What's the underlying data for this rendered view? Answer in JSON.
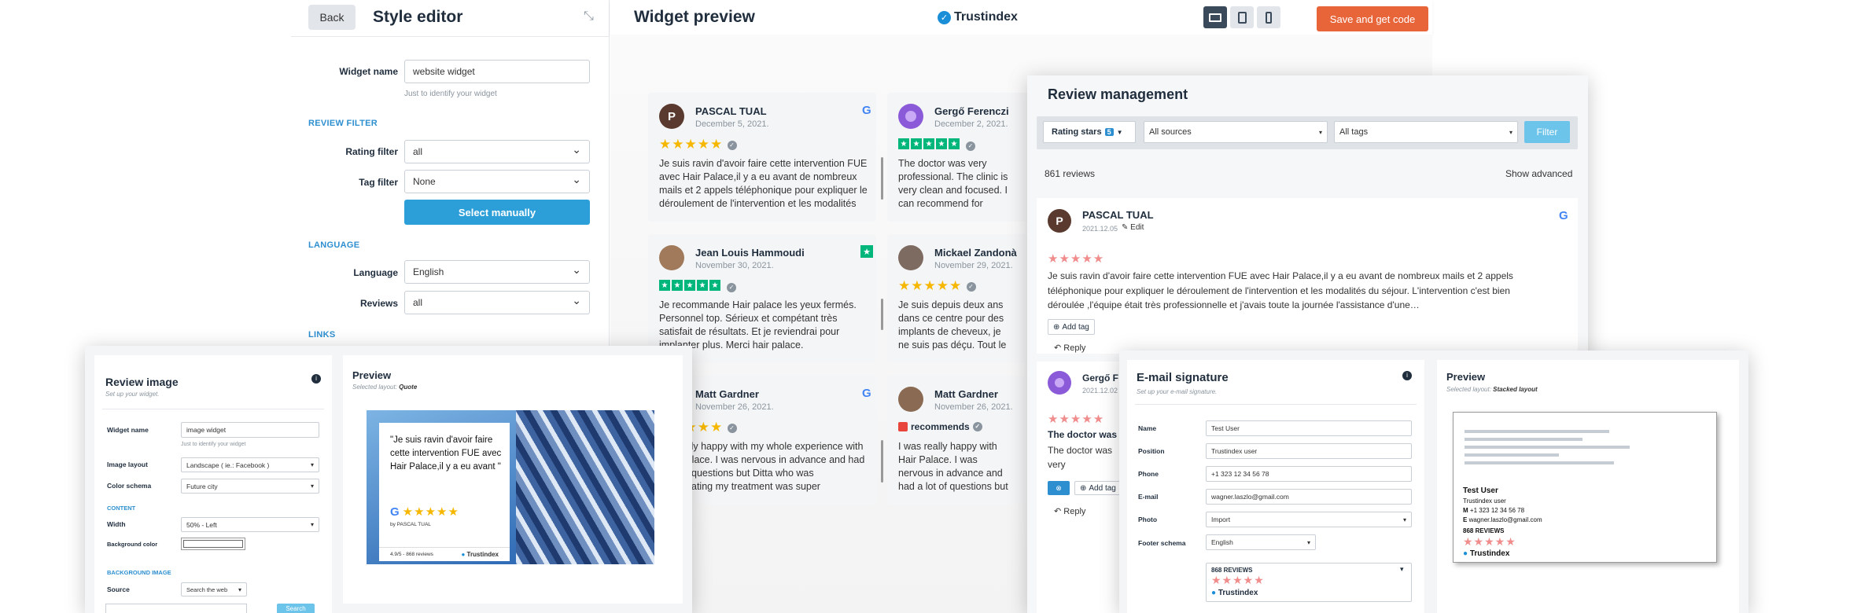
{
  "editor": {
    "back": "Back",
    "title": "Style editor",
    "widget_name_label": "Widget name",
    "widget_name_value": "website widget",
    "widget_name_hint": "Just to identify your widget",
    "review_filter_heading": "REVIEW FILTER",
    "rating_filter_label": "Rating filter",
    "rating_filter_value": "all",
    "tag_filter_label": "Tag filter",
    "tag_filter_value": "None",
    "select_manually": "Select manually",
    "language_heading": "LANGUAGE",
    "language_label": "Language",
    "language_value": "English",
    "reviews_label": "Reviews",
    "reviews_value": "all",
    "links_heading": "LINKS"
  },
  "preview_header": {
    "title": "Widget preview",
    "brand": "Trustindex",
    "save": "Save and get code"
  },
  "reviews": [
    {
      "initial": "P",
      "name": "PASCAL TUAL",
      "date": "December 5, 2021.",
      "text": "Je suis ravin d'avoir faire cette intervention FUE avec Hair Palace,il y a eu avant de nombreux mails et 2 appels téléphonique pour expliquer le déroulement de l'intervention et les modalités du"
    },
    {
      "initial": "",
      "name": "Gergő Ferenczi",
      "date": "December 2, 2021.",
      "text": "The doctor was very professional. The clinic is very clean and focused. I can recommend for everyone."
    },
    {
      "initial": "",
      "name": "Jean Louis Hammoudi",
      "date": "November 30, 2021.",
      "text": "Je recommande Hair palace les yeux fermés. Personnel top. Sérieux et compétant très satisfait de résultats. Et je reviendrai pour implanter plus. Merci hair palace."
    },
    {
      "initial": "",
      "name": "Mickael Zandonà",
      "date": "November 29, 2021.",
      "text": "Je suis depuis deux ans dans ce centre pour des implants de cheveux, je ne suis pas déçu. Tout le personnel est très bien dans l'organisation de"
    },
    {
      "initial": "",
      "name": "Matt Gardner",
      "date": "November 26, 2021.",
      "text": "I'm really happy with my whole experience with Hair Palace. I was nervous in advance and had a lot of questions but Ditta who was coordinating my treatment was super responsive and"
    },
    {
      "initial": "",
      "name": "Matt Gardner",
      "date": "November 26, 2021.",
      "recommends": "recommends",
      "text": "I was really happy with Hair Palace. I was nervous in advance and had a lot of questions but Ditta who was coordinating my treatment was super responsive and"
    }
  ],
  "management": {
    "title": "Review management",
    "rating_btn": "Rating stars",
    "rating_count": "5",
    "sources": "All sources",
    "tags": "All tags",
    "filter": "Filter",
    "count": "861 reviews",
    "show_advanced": "Show advanced",
    "r1": {
      "initial": "P",
      "name": "PASCAL TUAL",
      "date": "2021.12.05",
      "edit": "Edit",
      "text": "Je suis ravin d'avoir faire cette intervention FUE avec Hair Palace,il y a eu avant de nombreux mails et 2 appels téléphonique pour expliquer le déroulement de l'intervention et les modalités du séjour. L'intervention c'est bien déroulée ,l'équipe était très professionnelle et j'avais toute la journée l'assistance d'une…",
      "add_tag": "Add tag",
      "reply": "Reply"
    },
    "r2": {
      "name": "Gergő F",
      "date": "2021.12.02",
      "bold": "The doctor was",
      "text": "The doctor was very professional. The clinic is very clean and focused. I can recommend for everyone",
      "add_tag": "Add tag",
      "reply": "Reply"
    }
  },
  "review_image": {
    "title": "Review image",
    "subtitle": "Set up your widget.",
    "widget_name_label": "Widget name",
    "widget_name_value": "image widget",
    "widget_hint": "Just to identify your widget",
    "layout_label": "Image layout",
    "layout_value": "Landscape ( ie.: Facebook )",
    "color_label": "Color schema",
    "color_value": "Future city",
    "content_heading": "CONTENT",
    "width_label": "Width",
    "width_value": "50% - Left",
    "bg_label": "Background color",
    "bg_image_heading": "BACKGROUND IMAGE",
    "source_label": "Source",
    "source_value": "Search the web",
    "search": "Search",
    "preview_title": "Preview",
    "preview_layout_prefix": "Selected layout:",
    "preview_layout": "Quote",
    "quote": "\"Je suis ravin d'avoir faire cette intervention FUE avec Hair Palace,il y a eu avant \"",
    "by": "by PASCAL TUAL",
    "foot_rating": "4.9/5 - 868 reviews",
    "foot_brand": "Trustindex"
  },
  "email": {
    "title": "E-mail signature",
    "subtitle": "Set up your e-mail signature.",
    "name_label": "Name",
    "name_value": "Test User",
    "position_label": "Position",
    "position_value": "Trustindex user",
    "phone_label": "Phone",
    "phone_value": "+1 323 12 34 56 78",
    "email_label": "E-mail",
    "email_value": "wagner.laszlo@gmail.com",
    "photo_label": "Photo",
    "photo_value": "Import",
    "footer_label": "Footer schema",
    "footer_value": "English",
    "badge_count": "868 REVIEWS",
    "badge_brand": "Trustindex",
    "preview_title": "Preview",
    "preview_layout_prefix": "Selected layout:",
    "preview_layout": "Stacked layout",
    "sig_name": "Test User",
    "sig_pos": "Trustindex user",
    "sig_m": "M",
    "sig_phone": "+1 323 12 34 56 78",
    "sig_e": "E",
    "sig_email": "wagner.laszlo@gmail.com",
    "sig_reviews": "868 REVIEWS",
    "sig_brand": "Trustindex"
  },
  "colors": {
    "accent": "#2d8fd0",
    "save": "#e8653a",
    "google_blue": "#4285f4",
    "tp_green": "#00b67a",
    "star": "#f6b700",
    "pink": "#f08c8c"
  }
}
